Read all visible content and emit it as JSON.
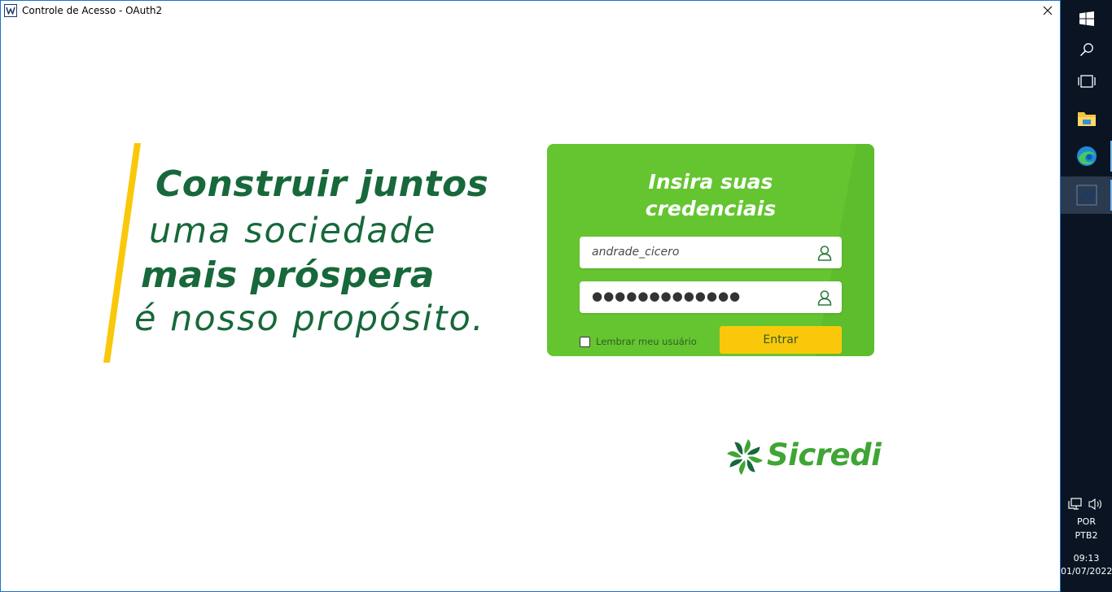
{
  "window": {
    "title": "Controle de Acesso - OAuth2",
    "close_symbol": "✕"
  },
  "slogan": {
    "line1": "Construir juntos",
    "line2": "uma sociedade",
    "line3": "mais próspera",
    "line4": "é nosso propósito."
  },
  "login": {
    "title_line1": "Insira suas",
    "title_line2": "credenciais",
    "username": "andrade_cicero",
    "password_masked": "●●●●●●●●●●●●●",
    "remember_label": "Lembrar meu usuário",
    "remember_checked": false,
    "submit_label": "Entrar"
  },
  "brand": {
    "name": "Sicredi"
  },
  "taskbar": {
    "items": [
      "windows-start-icon",
      "search-icon",
      "task-view-icon",
      "file-explorer-icon",
      "edge-browser-icon",
      "app-window-icon"
    ],
    "language_line1": "POR",
    "language_line2": "PTB2",
    "time": "09:13",
    "date": "01/07/2022"
  },
  "colors": {
    "card_green": "#64c530",
    "slogan_green": "#17683a",
    "accent_yellow": "#fac80a",
    "brand_green": "#3fa535",
    "taskbar_bg": "#0a1423"
  }
}
